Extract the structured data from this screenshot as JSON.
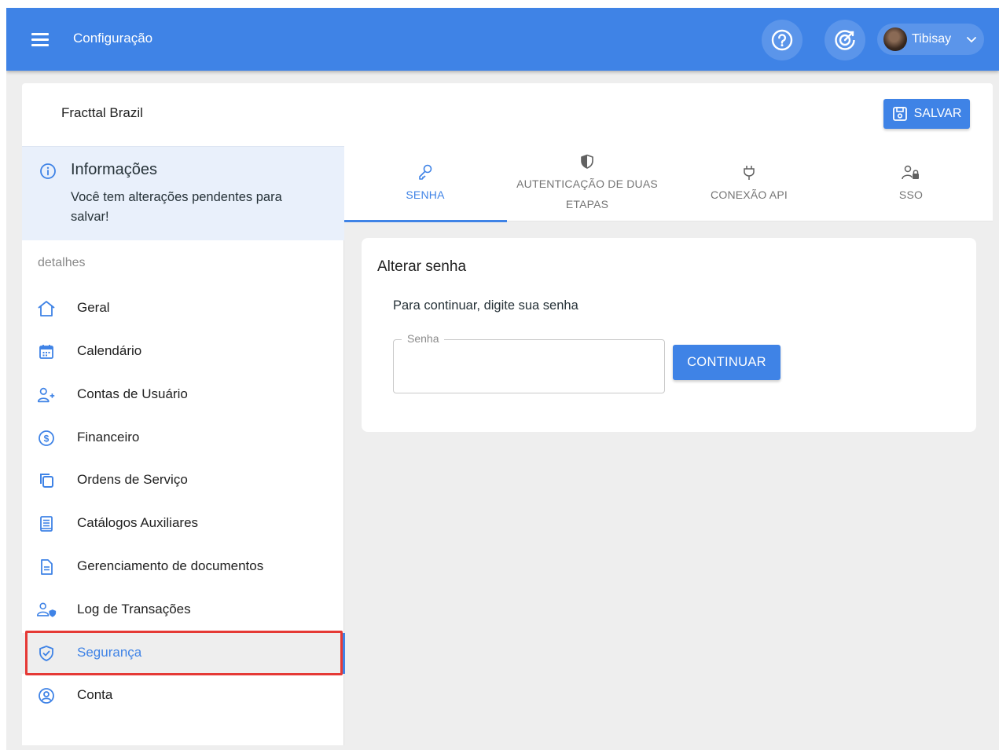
{
  "header": {
    "title": "Configuração",
    "user_name": "Tibisay"
  },
  "company": {
    "name": "Fracttal Brazil",
    "save_label": "SALVAR"
  },
  "info": {
    "title": "Informações",
    "text": "Você tem alterações pendentes para salvar!"
  },
  "sidebar": {
    "section_label": "detalhes",
    "items": [
      {
        "label": "Geral",
        "icon": "home-icon"
      },
      {
        "label": "Calendário",
        "icon": "calendar-icon"
      },
      {
        "label": "Contas de Usuário",
        "icon": "user-add-icon"
      },
      {
        "label": "Financeiro",
        "icon": "dollar-icon"
      },
      {
        "label": "Ordens de Serviço",
        "icon": "copy-icon"
      },
      {
        "label": "Catálogos Auxiliares",
        "icon": "book-icon"
      },
      {
        "label": "Gerenciamento de documentos",
        "icon": "document-icon"
      },
      {
        "label": "Log de Transações",
        "icon": "user-shield-icon"
      },
      {
        "label": "Segurança",
        "icon": "shield-check-icon",
        "active": true
      },
      {
        "label": "Conta",
        "icon": "account-circle-icon"
      }
    ]
  },
  "tabs": [
    {
      "label": "SENHA",
      "icon": "key-icon",
      "active": true
    },
    {
      "label_line1": "AUTENTICAÇÃO DE DUAS",
      "label_line2": "ETAPAS",
      "icon": "shield-half-icon"
    },
    {
      "label": "CONEXÃO API",
      "icon": "plug-icon"
    },
    {
      "label": "SSO",
      "icon": "user-lock-icon"
    }
  ],
  "password_card": {
    "title": "Alterar senha",
    "subtitle": "Para continuar, digite sua senha",
    "field_label": "Senha",
    "field_value": "",
    "continue_label": "CONTINUAR"
  },
  "colors": {
    "primary": "#3f83e6",
    "info_bg": "#e9f0fb",
    "highlight": "#e53935"
  }
}
